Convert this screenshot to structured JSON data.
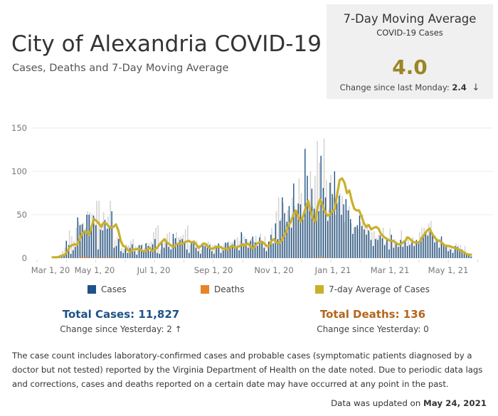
{
  "header": {
    "title": "City of Alexandria COVID-19",
    "subtitle": "Cases, Deaths and 7-Day Moving Average"
  },
  "kpi": {
    "title": "7-Day Moving Average",
    "subtitle": "COVID-19 Cases",
    "value": "4.0",
    "change_label": "Change since last Monday:",
    "change_value": "2.4",
    "change_arrow": "↓",
    "value_color": "#9b8624"
  },
  "legend": [
    {
      "label": "Cases",
      "color": "#1f5286"
    },
    {
      "label": "Deaths",
      "color": "#e8832a"
    },
    {
      "label": "7-day Average of Cases",
      "color": "#c9b02a"
    }
  ],
  "totals": {
    "cases_label": "Total Cases: 11,827",
    "cases_change": "Change since Yesterday: 2 ↑",
    "cases_color": "#1f5286",
    "deaths_label": "Total Deaths: 136",
    "deaths_change": "Change since Yesterday: 0",
    "deaths_color": "#b5651d"
  },
  "note": "The case count includes laboratory-confirmed cases and probable cases (symptomatic patients diagnosed by a doctor but not tested) reported by the Virginia Department of Health on the date noted. Due to periodic data lags and corrections, cases and deaths reported on a certain date may have occurred at any point in the past.",
  "updated": {
    "prefix": "Data was updated on",
    "date": "May 24, 2021"
  },
  "chart_data": {
    "type": "bar",
    "title": "Cases, Deaths and 7-Day Moving Average",
    "xlabel": "",
    "ylabel": "",
    "ylim": [
      0,
      160
    ],
    "yticks": [
      0,
      50,
      100,
      150
    ],
    "grid": true,
    "legend_position": "bottom",
    "x_start": "2020-03-07",
    "x_end": "2021-05-24",
    "xtick_labels": [
      "Mar 1, 20",
      "May 1, 20",
      "Jul 1, 20",
      "Sep 1, 20",
      "Nov 1, 20",
      "Jan 1, 21",
      "Mar 1, 21",
      "May 1, 21"
    ],
    "sample_interval_days": 3,
    "series": [
      {
        "name": "Cases",
        "type": "bar",
        "color": "#1f5286",
        "values": [
          0,
          1,
          2,
          3,
          4,
          5,
          20,
          15,
          5,
          9,
          13,
          47,
          38,
          39,
          30,
          50,
          50,
          38,
          49,
          38,
          10,
          33,
          32,
          44,
          34,
          35,
          54,
          12,
          14,
          22,
          8,
          6,
          14,
          6,
          12,
          16,
          8,
          4,
          15,
          15,
          7,
          17,
          14,
          8,
          16,
          22,
          6,
          5,
          20,
          12,
          18,
          13,
          10,
          28,
          23,
          17,
          21,
          22,
          17,
          10,
          6,
          18,
          19,
          12,
          8,
          5,
          17,
          14,
          12,
          15,
          8,
          5,
          14,
          17,
          6,
          9,
          18,
          18,
          12,
          16,
          21,
          12,
          9,
          30,
          17,
          22,
          12,
          20,
          25,
          18,
          14,
          24,
          20,
          12,
          8,
          19,
          27,
          17,
          40,
          22,
          43,
          70,
          52,
          42,
          60,
          35,
          86,
          55,
          63,
          62,
          47,
          126,
          95,
          60,
          80,
          57,
          48,
          54,
          118,
          81,
          70,
          43,
          87,
          74,
          100,
          63,
          72,
          50,
          62,
          68,
          55,
          45,
          28,
          36,
          38,
          49,
          37,
          33,
          27,
          32,
          21,
          14,
          22,
          21,
          26,
          23,
          15,
          23,
          10,
          27,
          12,
          18,
          13,
          21,
          13,
          20,
          14,
          15,
          18,
          14,
          21,
          17,
          24,
          24,
          29,
          26,
          34,
          30,
          18,
          21,
          12,
          25,
          17,
          14,
          8,
          10,
          6,
          14,
          13,
          10,
          10,
          5,
          4,
          3,
          2
        ],
        "secondary_values": [
          0,
          1,
          2,
          4,
          8,
          12,
          10,
          32,
          25,
          20,
          35,
          42,
          39,
          41,
          35,
          54,
          53,
          51,
          40,
          66,
          66,
          40,
          53,
          33,
          48,
          66,
          36,
          21,
          24,
          23,
          12,
          10,
          16,
          15,
          20,
          22,
          14,
          10,
          15,
          16,
          12,
          18,
          17,
          19,
          30,
          35,
          38,
          10,
          20,
          22,
          28,
          30,
          15,
          22,
          30,
          24,
          25,
          27,
          33,
          38,
          15,
          18,
          21,
          20,
          15,
          10,
          18,
          18,
          19,
          17,
          15,
          16,
          15,
          14,
          12,
          16,
          17,
          20,
          18,
          19,
          22,
          24,
          20,
          28,
          25,
          22,
          18,
          23,
          20,
          26,
          15,
          28,
          20,
          25,
          14,
          20,
          35,
          20,
          54,
          70,
          46,
          64,
          38,
          55,
          48,
          70,
          60,
          47,
          92,
          75,
          45,
          60,
          68,
          100,
          60,
          95,
          135,
          110,
          60,
          138,
          90,
          56,
          96,
          70,
          50,
          65,
          75,
          72,
          42,
          56,
          60,
          40,
          35,
          36,
          34,
          42,
          50,
          39,
          40,
          30,
          30,
          31,
          23,
          27,
          28,
          35,
          18,
          20,
          34,
          20,
          22,
          18,
          14,
          32,
          20,
          25,
          21,
          17,
          24,
          17,
          18,
          30,
          35,
          35,
          30,
          40,
          43,
          28,
          26,
          20,
          22,
          18,
          13,
          16,
          15,
          13,
          9,
          17,
          15,
          15,
          9,
          14,
          6,
          5,
          2
        ]
      },
      {
        "name": "Deaths",
        "type": "bar",
        "color": "#e8832a",
        "values": [
          0,
          0,
          0,
          0,
          0,
          0,
          0,
          0,
          1,
          0,
          1,
          0,
          2,
          1,
          3,
          2,
          0,
          1,
          0,
          2,
          0,
          0,
          1,
          0,
          2,
          1,
          0,
          1,
          0,
          1,
          0,
          0,
          0,
          0,
          0,
          0,
          0,
          0,
          0,
          0,
          0,
          0,
          0,
          0,
          0,
          0,
          0,
          0,
          0,
          0,
          0,
          0,
          0,
          0,
          0,
          0,
          0,
          0,
          0,
          0,
          0,
          0,
          0,
          0,
          0,
          0,
          1,
          0,
          0,
          0,
          0,
          0,
          0,
          0,
          0,
          0,
          0,
          0,
          0,
          0,
          0,
          0,
          0,
          0,
          0,
          0,
          0,
          0,
          0,
          0,
          0,
          0,
          0,
          0,
          0,
          0,
          0,
          0,
          0,
          0,
          0,
          0,
          0,
          0,
          0,
          1,
          0,
          0,
          0,
          0,
          0,
          0,
          0,
          0,
          0,
          1,
          0,
          1,
          2,
          1,
          0,
          0,
          1,
          0,
          0,
          0,
          0,
          0,
          0,
          0,
          0,
          0,
          0,
          0,
          0,
          0,
          0,
          0,
          0,
          0,
          0,
          0,
          0,
          0,
          0,
          1,
          0,
          0,
          0,
          0,
          0,
          0,
          0,
          0,
          0,
          0,
          0,
          0,
          0,
          0,
          0,
          0,
          0,
          0,
          0,
          0,
          0,
          0,
          0,
          0,
          0,
          0,
          0,
          0,
          0,
          0,
          0,
          0,
          0,
          0,
          0,
          0,
          0,
          0,
          0
        ]
      },
      {
        "name": "7-day Average of Cases",
        "type": "line",
        "color": "#c9b02a",
        "values": [
          1,
          1,
          1,
          2,
          3,
          4,
          7,
          13,
          15,
          16,
          15,
          21,
          28,
          31,
          30,
          27,
          36,
          45,
          43,
          40,
          36,
          41,
          40,
          37,
          35,
          36,
          39,
          32,
          20,
          14,
          13,
          9,
          7,
          10,
          10,
          11,
          10,
          8,
          8,
          10,
          12,
          8,
          10,
          12,
          16,
          19,
          22,
          18,
          16,
          14,
          13,
          16,
          17,
          16,
          18,
          19,
          20,
          18,
          19,
          16,
          12,
          14,
          17,
          16,
          13,
          11,
          11,
          13,
          13,
          13,
          11,
          11,
          10,
          13,
          14,
          12,
          13,
          14,
          16,
          14,
          17,
          15,
          11,
          13,
          17,
          18,
          19,
          17,
          14,
          14,
          20,
          22,
          18,
          17,
          20,
          25,
          30,
          38,
          42,
          50,
          55,
          47,
          42,
          48,
          58,
          66,
          55,
          46,
          42,
          60,
          68,
          60,
          53,
          49,
          50,
          54,
          56,
          74,
          90,
          92,
          87,
          75,
          78,
          66,
          57,
          55,
          55,
          48,
          40,
          36,
          38,
          33,
          35,
          36,
          34,
          28,
          25,
          23,
          21,
          20,
          20,
          18,
          16,
          16,
          18,
          20,
          24,
          22,
          19,
          18,
          18,
          19,
          24,
          28,
          32,
          34,
          28,
          24,
          21,
          20,
          18,
          15,
          14,
          14,
          13,
          12,
          11,
          10,
          8,
          7,
          5,
          4,
          4
        ]
      }
    ]
  }
}
